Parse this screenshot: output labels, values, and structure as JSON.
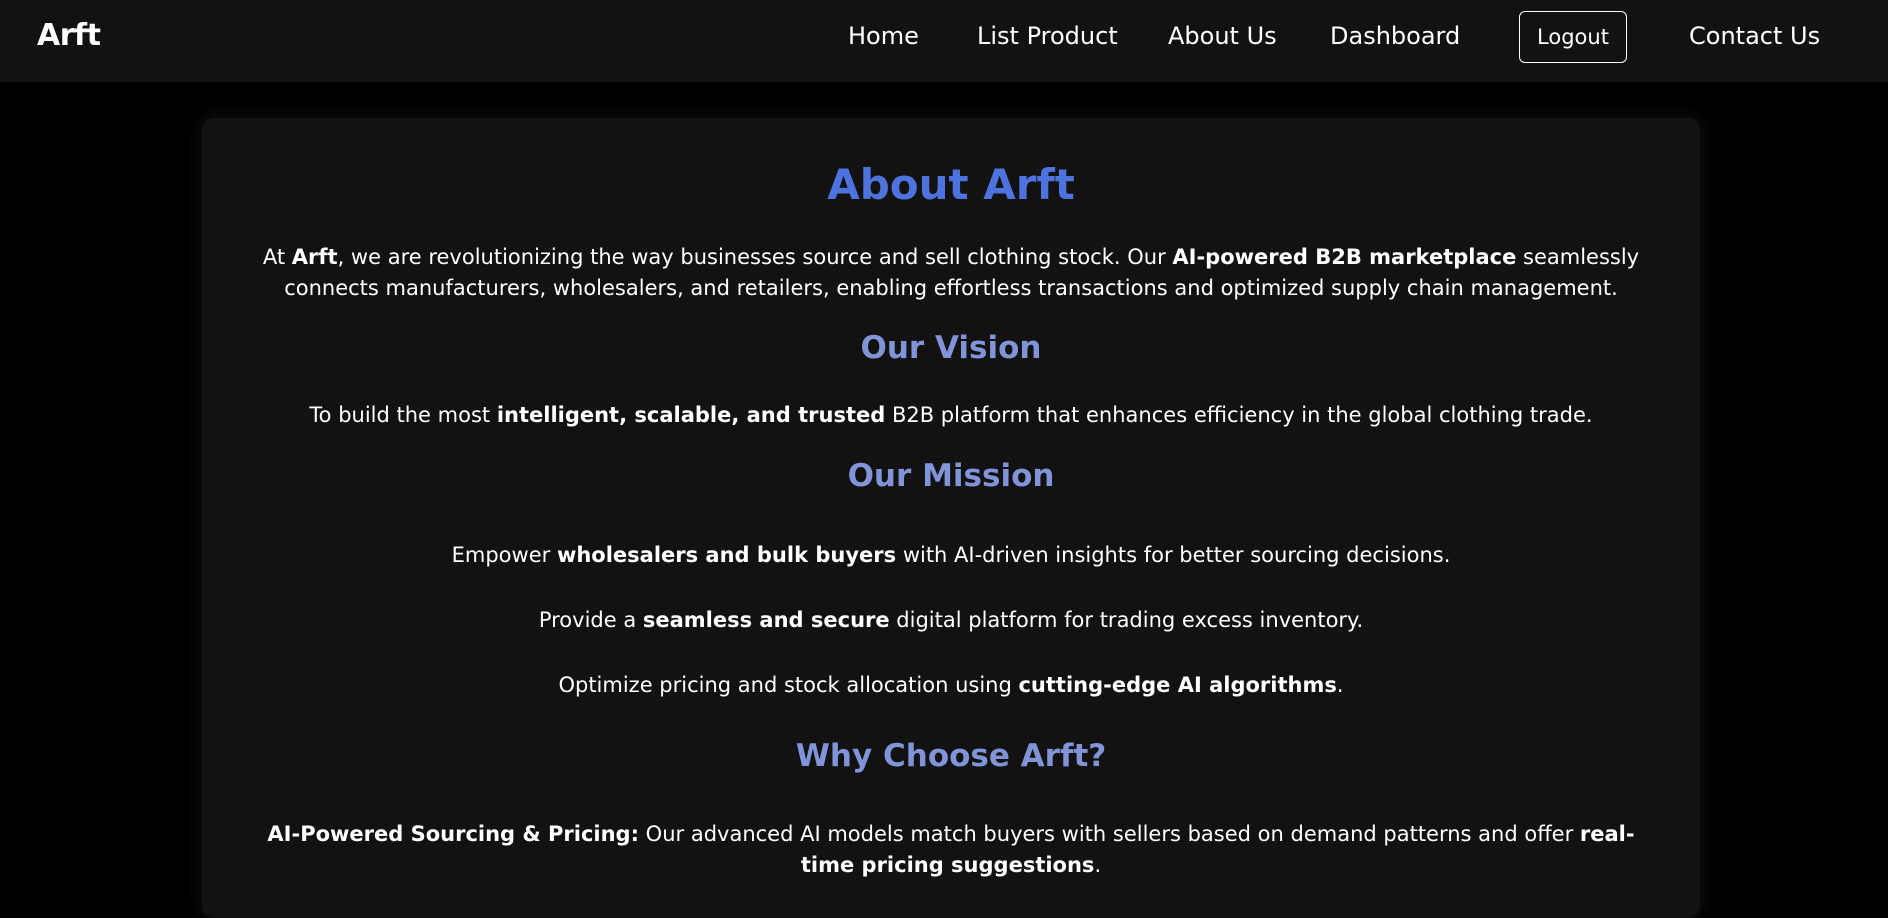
{
  "nav": {
    "brand": "Arft",
    "home": "Home",
    "list_product": "List Product",
    "about_us": "About Us",
    "dashboard": "Dashboard",
    "logout": "Logout",
    "contact_us": "Contact Us"
  },
  "about": {
    "title": "About Arft",
    "intro": {
      "t1": "At ",
      "b1": "Arft",
      "t2": ", we are revolutionizing the way businesses source and sell clothing stock. Our ",
      "b2": "AI-powered B2B marketplace",
      "t3": " seamlessly connects manufacturers, wholesalers, and retailers, enabling effortless transactions and optimized supply chain management."
    },
    "vision_title": "Our Vision",
    "vision": {
      "t1": "To build the most ",
      "b1": "intelligent, scalable, and trusted",
      "t2": " B2B platform that enhances efficiency in the global clothing trade."
    },
    "mission_title": "Our Mission",
    "mission": [
      {
        "t1": "Empower ",
        "b1": "wholesalers and bulk buyers",
        "t2": " with AI-driven insights for better sourcing decisions."
      },
      {
        "t1": "Provide a ",
        "b1": "seamless and secure",
        "t2": " digital platform for trading excess inventory."
      },
      {
        "t1": "Optimize pricing and stock allocation using ",
        "b1": "cutting-edge AI algorithms",
        "t2": "."
      }
    ],
    "why_title": "Why Choose Arft?",
    "why": [
      {
        "b1": "AI-Powered Sourcing & Pricing:",
        "t1": " Our advanced AI models match buyers with sellers based on demand patterns and offer ",
        "b2": "real-time pricing suggestions",
        "t2": "."
      }
    ]
  },
  "colors": {
    "background": "#000000",
    "navbar": "#121212",
    "card": "#121212",
    "title": "#4f73de",
    "subtitle": "#8194d8",
    "text": "#ffffff"
  }
}
